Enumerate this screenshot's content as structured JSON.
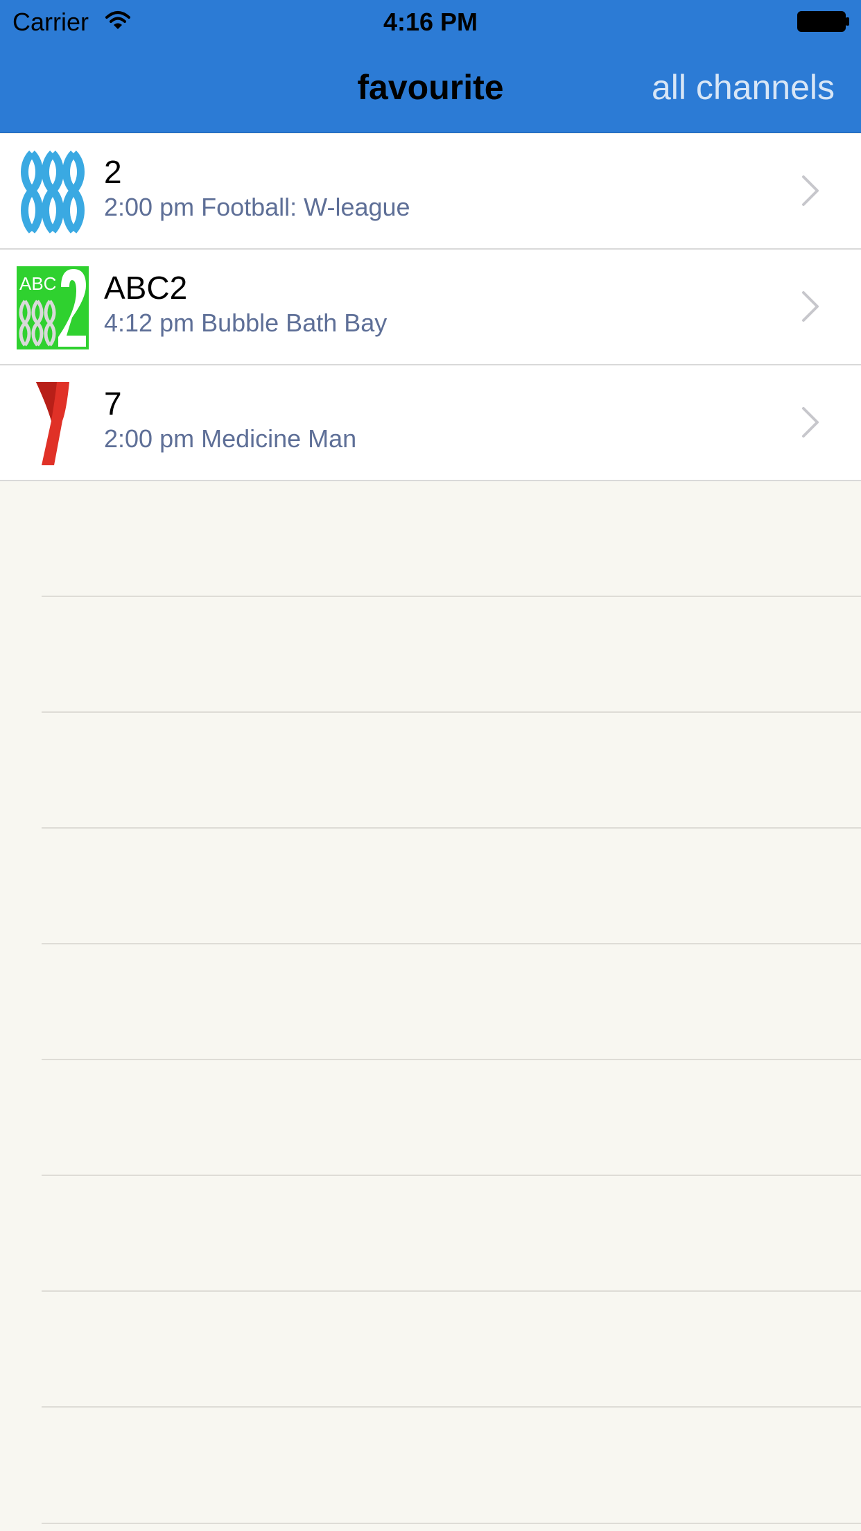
{
  "status_bar": {
    "carrier": "Carrier",
    "time": "4:16 PM",
    "wifi_icon": "wifi-icon",
    "battery_icon": "battery-full-icon"
  },
  "nav": {
    "title": "favourite",
    "right_button": "all channels"
  },
  "channels": [
    {
      "name": "2",
      "program": "2:00 pm Football: W-league",
      "logo": "abc-logo-icon"
    },
    {
      "name": "ABC2",
      "program": "4:12 pm Bubble Bath Bay",
      "logo": "abc2-logo-icon"
    },
    {
      "name": "7",
      "program": "2:00 pm Medicine Man",
      "logo": "seven-logo-icon"
    }
  ],
  "colors": {
    "nav_bar": "#2c7bd5",
    "background": "#f8f7f1",
    "subtitle": "#5e6f97",
    "nav_button": "#d8e6f6"
  }
}
